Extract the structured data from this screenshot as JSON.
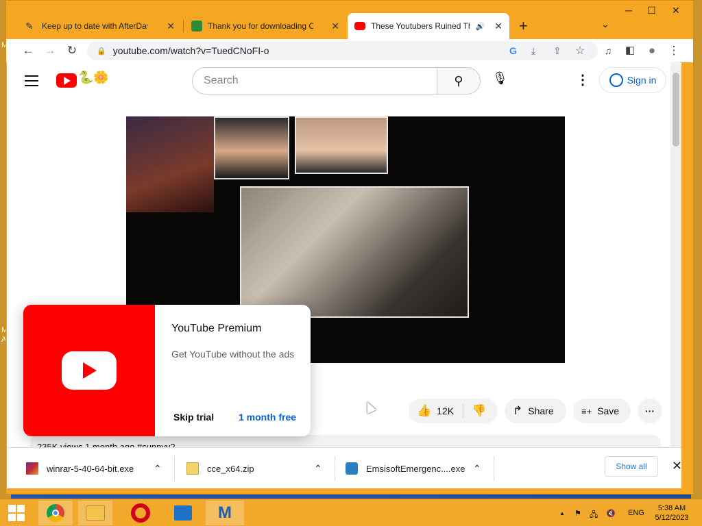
{
  "browser": {
    "tabs": [
      {
        "title": "Keep up to date with AfterDawn!",
        "close": "✕"
      },
      {
        "title": "Thank you for downloading Com",
        "close": "✕"
      },
      {
        "title": "These Youtubers Ruined The",
        "close": "✕"
      }
    ],
    "new_tab": "+",
    "tab_menu": "⌄",
    "window_controls": {
      "minimize": "─",
      "maximize": "☐",
      "close": "✕"
    },
    "url": "youtube.com/watch?v=TuedCNoFI-o",
    "nav": {
      "back": "←",
      "forward": "→",
      "reload": "↻"
    },
    "icons": {
      "lock": "lock-icon",
      "google": "google-icon",
      "install": "install-icon",
      "share": "share-icon",
      "bookmark": "star-icon",
      "media": "media-control-icon",
      "sidepanel": "side-panel-icon",
      "profile": "profile-icon",
      "menu": "kebab-menu-icon"
    },
    "glyphs": {
      "lock": "🔒",
      "google": "G",
      "install": "⤓",
      "share": "⇪",
      "star": "☆",
      "media": "♫",
      "side": "◧",
      "profile": "●",
      "menu": "⋮",
      "audio": "🔊"
    }
  },
  "youtube": {
    "search_placeholder": "Search",
    "search_glyph": "⚲",
    "mic_glyph": "🎙",
    "more_glyph": "⋮",
    "sign_in": "Sign in",
    "doodle_glyph": "🐍🌼",
    "like_count": "12K",
    "like_glyph": "👍",
    "dislike_glyph": "👎",
    "share_label": "Share",
    "share_glyph": "↱",
    "save_label": "Save",
    "save_glyph": "≡+",
    "more_actions_glyph": "···",
    "meta_text": "235K views  1 month ago  #sunnyv2"
  },
  "promo": {
    "title": "YouTube Premium",
    "subtitle": "Get YouTube without the ads",
    "skip": "Skip trial",
    "free": "1 month free"
  },
  "downloads": {
    "items": [
      {
        "name": "winrar-5-40-64-bit.exe",
        "icon": "winrar-icon"
      },
      {
        "name": "cce_x64.zip",
        "icon": "zip-icon"
      },
      {
        "name": "EmsisoftEmergenc....exe",
        "icon": "emsisoft-icon"
      }
    ],
    "caret": "⌃",
    "show_all": "Show all",
    "close": "✕"
  },
  "taskbar": {
    "apps": [
      "start-icon",
      "chrome-icon",
      "file-explorer-icon",
      "opera-icon",
      "remote-desktop-icon",
      "malwarebytes-icon"
    ],
    "tray": {
      "up_arrow": "▲",
      "lang": "ENG",
      "flag": "⚑",
      "network": "🖧",
      "volume": "🔇"
    },
    "time": "5:38 AM",
    "date": "5/12/2023"
  },
  "desktop": {
    "labels": [
      "M",
      "M",
      "A"
    ]
  },
  "colors": {
    "accent_orange": "#f5a623",
    "yt_red": "#ff0000",
    "link_blue": "#065fd4"
  }
}
